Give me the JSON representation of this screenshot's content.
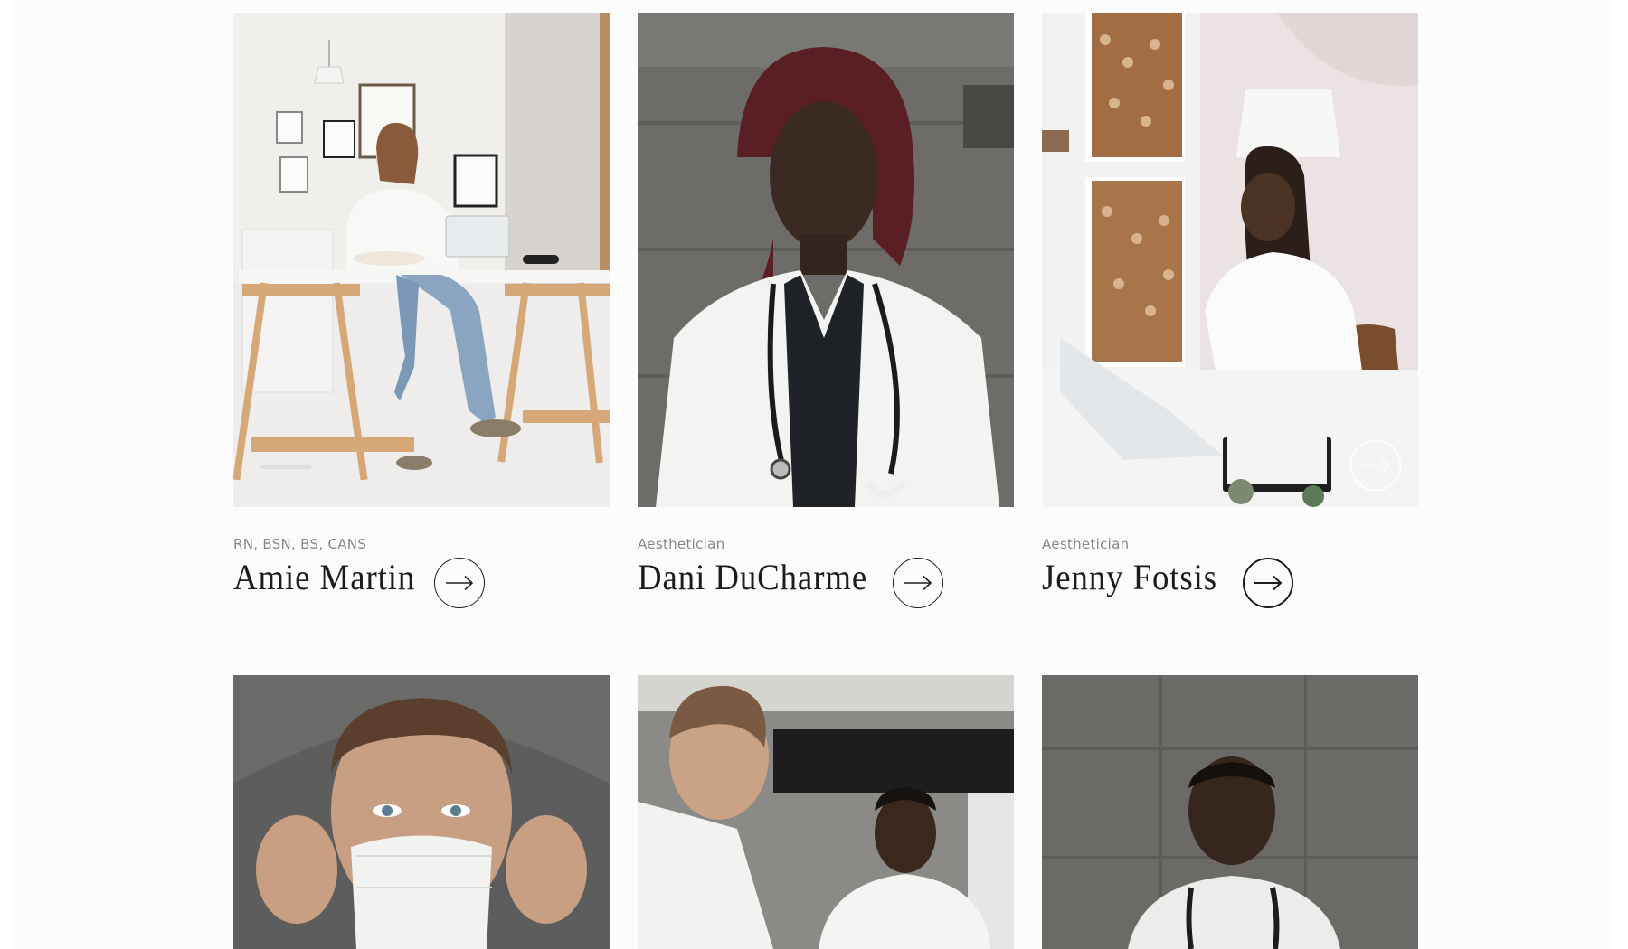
{
  "team": [
    {
      "credential": "RN, BSN, BS, CANS",
      "name": "Amie Martin",
      "photo_icon": "woman-at-desk-on-phone-photo",
      "button_icon": "arrow-right-icon"
    },
    {
      "credential": "Aesthetician",
      "name": "Dani DuCharme",
      "photo_icon": "doctor-with-stethoscope-portrait-photo",
      "button_icon": "arrow-right-icon"
    },
    {
      "credential": "Aesthetician",
      "name": "Jenny Fotsis",
      "photo_icon": "woman-typing-on-laptop-photo",
      "button_icon": "arrow-right-icon",
      "photo_overlay_icon": "arrow-right-icon"
    }
  ],
  "team_row_2": [
    {
      "photo_icon": "man-putting-on-face-mask-photo"
    },
    {
      "photo_icon": "two-doctors-in-consultation-photo"
    },
    {
      "photo_icon": "doctor-portrait-concrete-wall-photo"
    }
  ],
  "colors": {
    "page_background": "#fdfcfd",
    "name_text": "#1e1b1c",
    "credential_text": "#8a8587"
  }
}
